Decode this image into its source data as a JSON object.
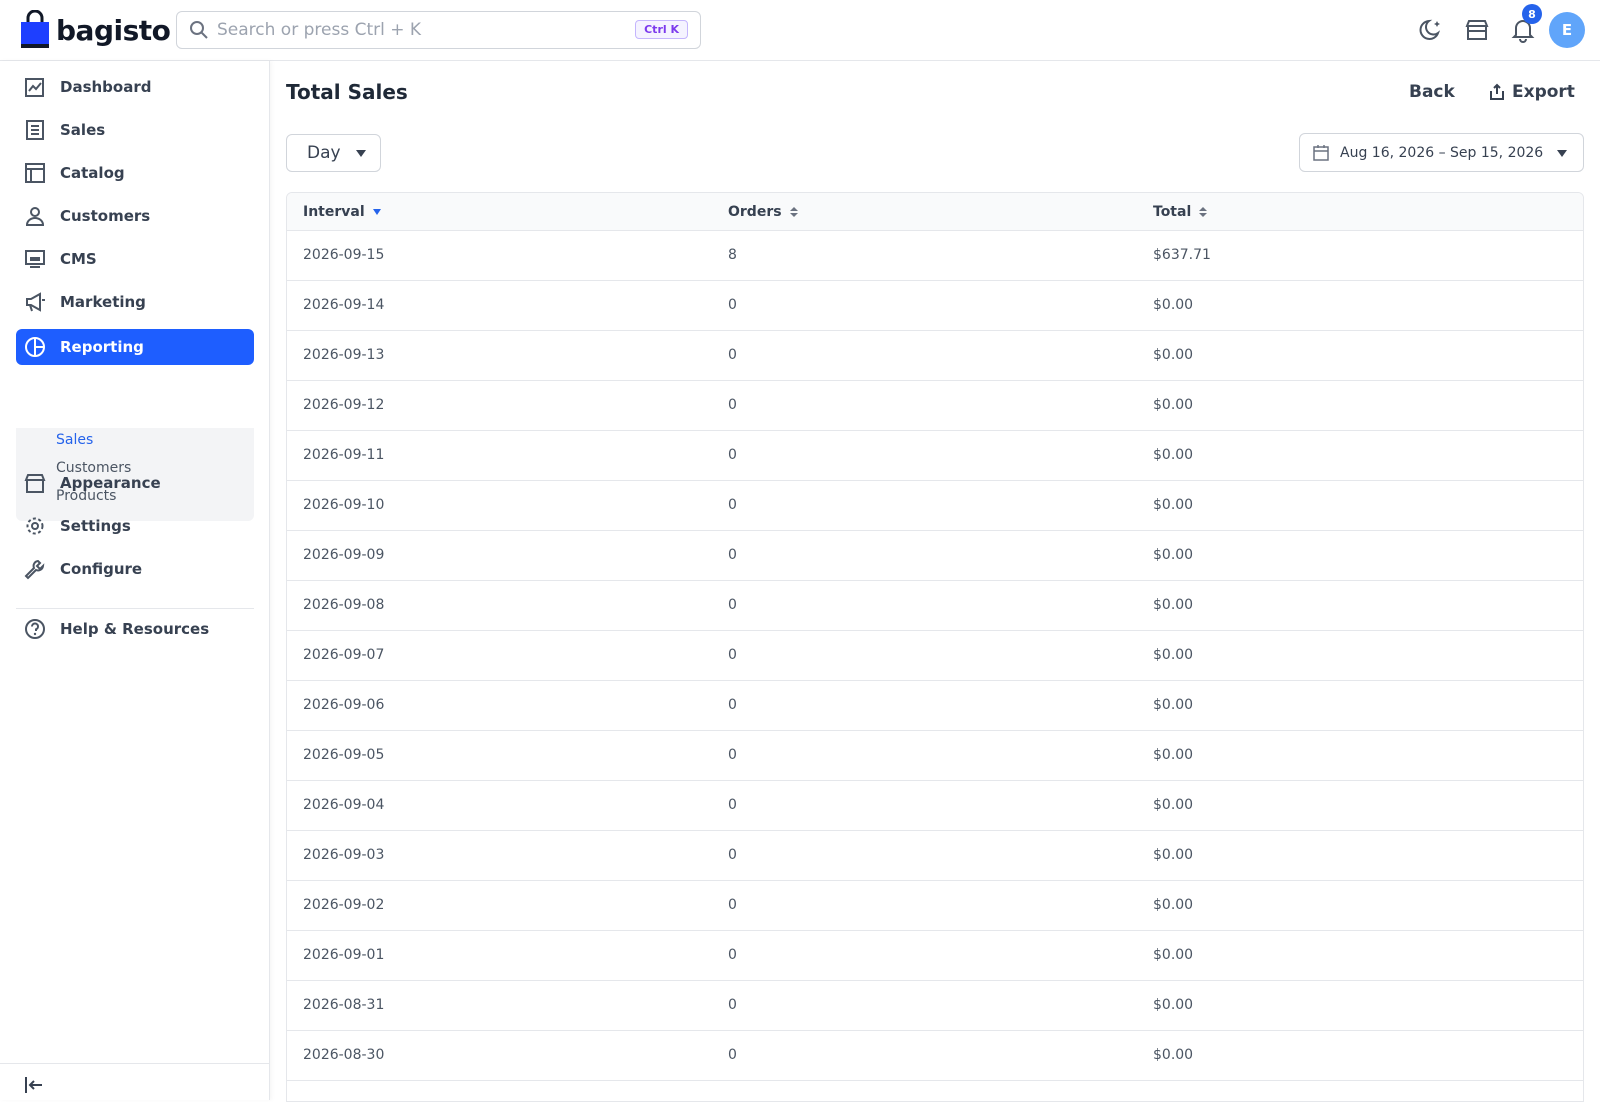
{
  "header": {
    "brand": "bagisto",
    "search_placeholder": "Search or press Ctrl + K",
    "shortcut": "Ctrl K",
    "notification_count": "8",
    "avatar_initial": "E"
  },
  "sidebar": {
    "items": [
      {
        "label": "Dashboard",
        "icon": "dashboard-icon"
      },
      {
        "label": "Sales",
        "icon": "receipt-icon"
      },
      {
        "label": "Catalog",
        "icon": "catalog-icon"
      },
      {
        "label": "Customers",
        "icon": "person-icon"
      },
      {
        "label": "CMS",
        "icon": "monitor-icon"
      },
      {
        "label": "Marketing",
        "icon": "megaphone-icon"
      },
      {
        "label": "Reporting",
        "icon": "pie-chart-icon"
      },
      {
        "label": "Appearance",
        "icon": "storefront-icon"
      },
      {
        "label": "Settings",
        "icon": "gear-icon"
      },
      {
        "label": "Configure",
        "icon": "wrench-icon"
      },
      {
        "label": "Help & Resources",
        "icon": "help-circle-icon"
      }
    ],
    "active": "Reporting",
    "submenu": [
      {
        "label": "Sales",
        "active": true
      },
      {
        "label": "Customers",
        "active": false
      },
      {
        "label": "Products",
        "active": false
      }
    ]
  },
  "main": {
    "title": "Total Sales",
    "back_label": "Back",
    "export_label": "Export",
    "interval_select": "Day",
    "date_range": "Aug 16, 2026 – Sep 15, 2026",
    "columns": [
      "Interval",
      "Orders",
      "Total"
    ],
    "rows": [
      [
        "2026-09-15",
        "8",
        "$637.71"
      ],
      [
        "2026-09-14",
        "0",
        "$0.00"
      ],
      [
        "2026-09-13",
        "0",
        "$0.00"
      ],
      [
        "2026-09-12",
        "0",
        "$0.00"
      ],
      [
        "2026-09-11",
        "0",
        "$0.00"
      ],
      [
        "2026-09-10",
        "0",
        "$0.00"
      ],
      [
        "2026-09-09",
        "0",
        "$0.00"
      ],
      [
        "2026-09-08",
        "0",
        "$0.00"
      ],
      [
        "2026-09-07",
        "0",
        "$0.00"
      ],
      [
        "2026-09-06",
        "0",
        "$0.00"
      ],
      [
        "2026-09-05",
        "0",
        "$0.00"
      ],
      [
        "2026-09-04",
        "0",
        "$0.00"
      ],
      [
        "2026-09-03",
        "0",
        "$0.00"
      ],
      [
        "2026-09-02",
        "0",
        "$0.00"
      ],
      [
        "2026-09-01",
        "0",
        "$0.00"
      ],
      [
        "2026-08-31",
        "0",
        "$0.00"
      ],
      [
        "2026-08-30",
        "0",
        "$0.00"
      ]
    ]
  },
  "colors": {
    "accent": "#1e5eff",
    "link": "#2563eb"
  }
}
